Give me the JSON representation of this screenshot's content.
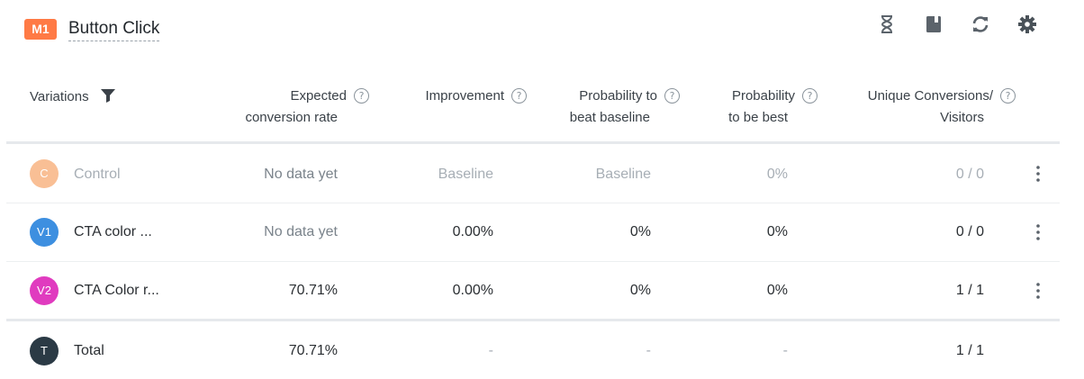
{
  "header": {
    "badge": "M1",
    "title": "Button Click",
    "tools": [
      "hourglass-icon",
      "book-icon",
      "refresh-icon",
      "gear-icon"
    ]
  },
  "table": {
    "columns": {
      "variations": "Variations",
      "expected_1": "Expected",
      "expected_2": "conversion rate",
      "improvement": "Improvement",
      "prob_beat_1": "Probability to",
      "prob_beat_2": "beat baseline",
      "prob_best_1": "Probability",
      "prob_best_2": "to be best",
      "unique_1": "Unique Conversions/",
      "unique_2": "Visitors"
    },
    "help_glyph": "?",
    "rows": [
      {
        "avatar": "C",
        "color": "#f9bf95",
        "name": "Control",
        "expected": "No data yet",
        "improvement": "Baseline",
        "prob_beat": "Baseline",
        "prob_best": "0%",
        "unique": "0 / 0"
      },
      {
        "avatar": "V1",
        "color": "#3d8fe0",
        "name": "CTA color ...",
        "expected": "No data yet",
        "improvement": "0.00%",
        "prob_beat": "0%",
        "prob_best": "0%",
        "unique": "0 / 0"
      },
      {
        "avatar": "V2",
        "color": "#e03bbf",
        "name": "CTA Color r...",
        "expected": "70.71%",
        "improvement": "0.00%",
        "prob_beat": "0%",
        "prob_best": "0%",
        "unique": "1 / 1"
      }
    ],
    "total": {
      "avatar": "T",
      "color": "#2b3a45",
      "name": "Total",
      "expected": "70.71%",
      "improvement": "-",
      "prob_beat": "-",
      "prob_best": "-",
      "unique": "1 / 1"
    }
  }
}
